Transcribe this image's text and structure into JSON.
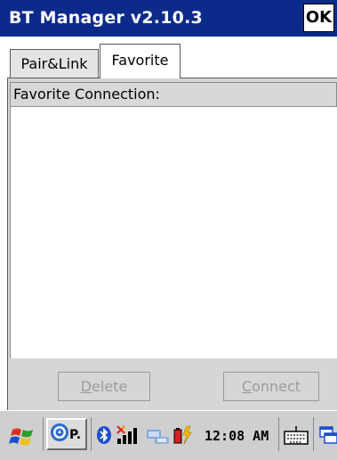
{
  "window": {
    "title": "BT Manager v2.10.3",
    "ok_label": "OK"
  },
  "tabs": [
    {
      "label": "Pair&Link",
      "active": false
    },
    {
      "label": "Favorite",
      "active": true
    }
  ],
  "favorite": {
    "list_header": "Favorite Connection:",
    "items": [],
    "delete_label": "Delete",
    "connect_label": "Connect",
    "delete_mnemonic": "D",
    "connect_mnemonic": "C"
  },
  "taskbar": {
    "start_icon": "windows-flag-icon",
    "task_label": "P.",
    "task_icon": "pocket-app-icon",
    "tray_icons": [
      "bluetooth-icon",
      "signal-icon",
      "network-icon",
      "battery-charging-icon",
      "keyboard-icon",
      "window-switch-icon"
    ],
    "clock": "12:08 AM"
  },
  "colors": {
    "titlebar": "#0b2a8a",
    "panel": "#d6d6d6",
    "taskbar": "#cfcfcf"
  }
}
